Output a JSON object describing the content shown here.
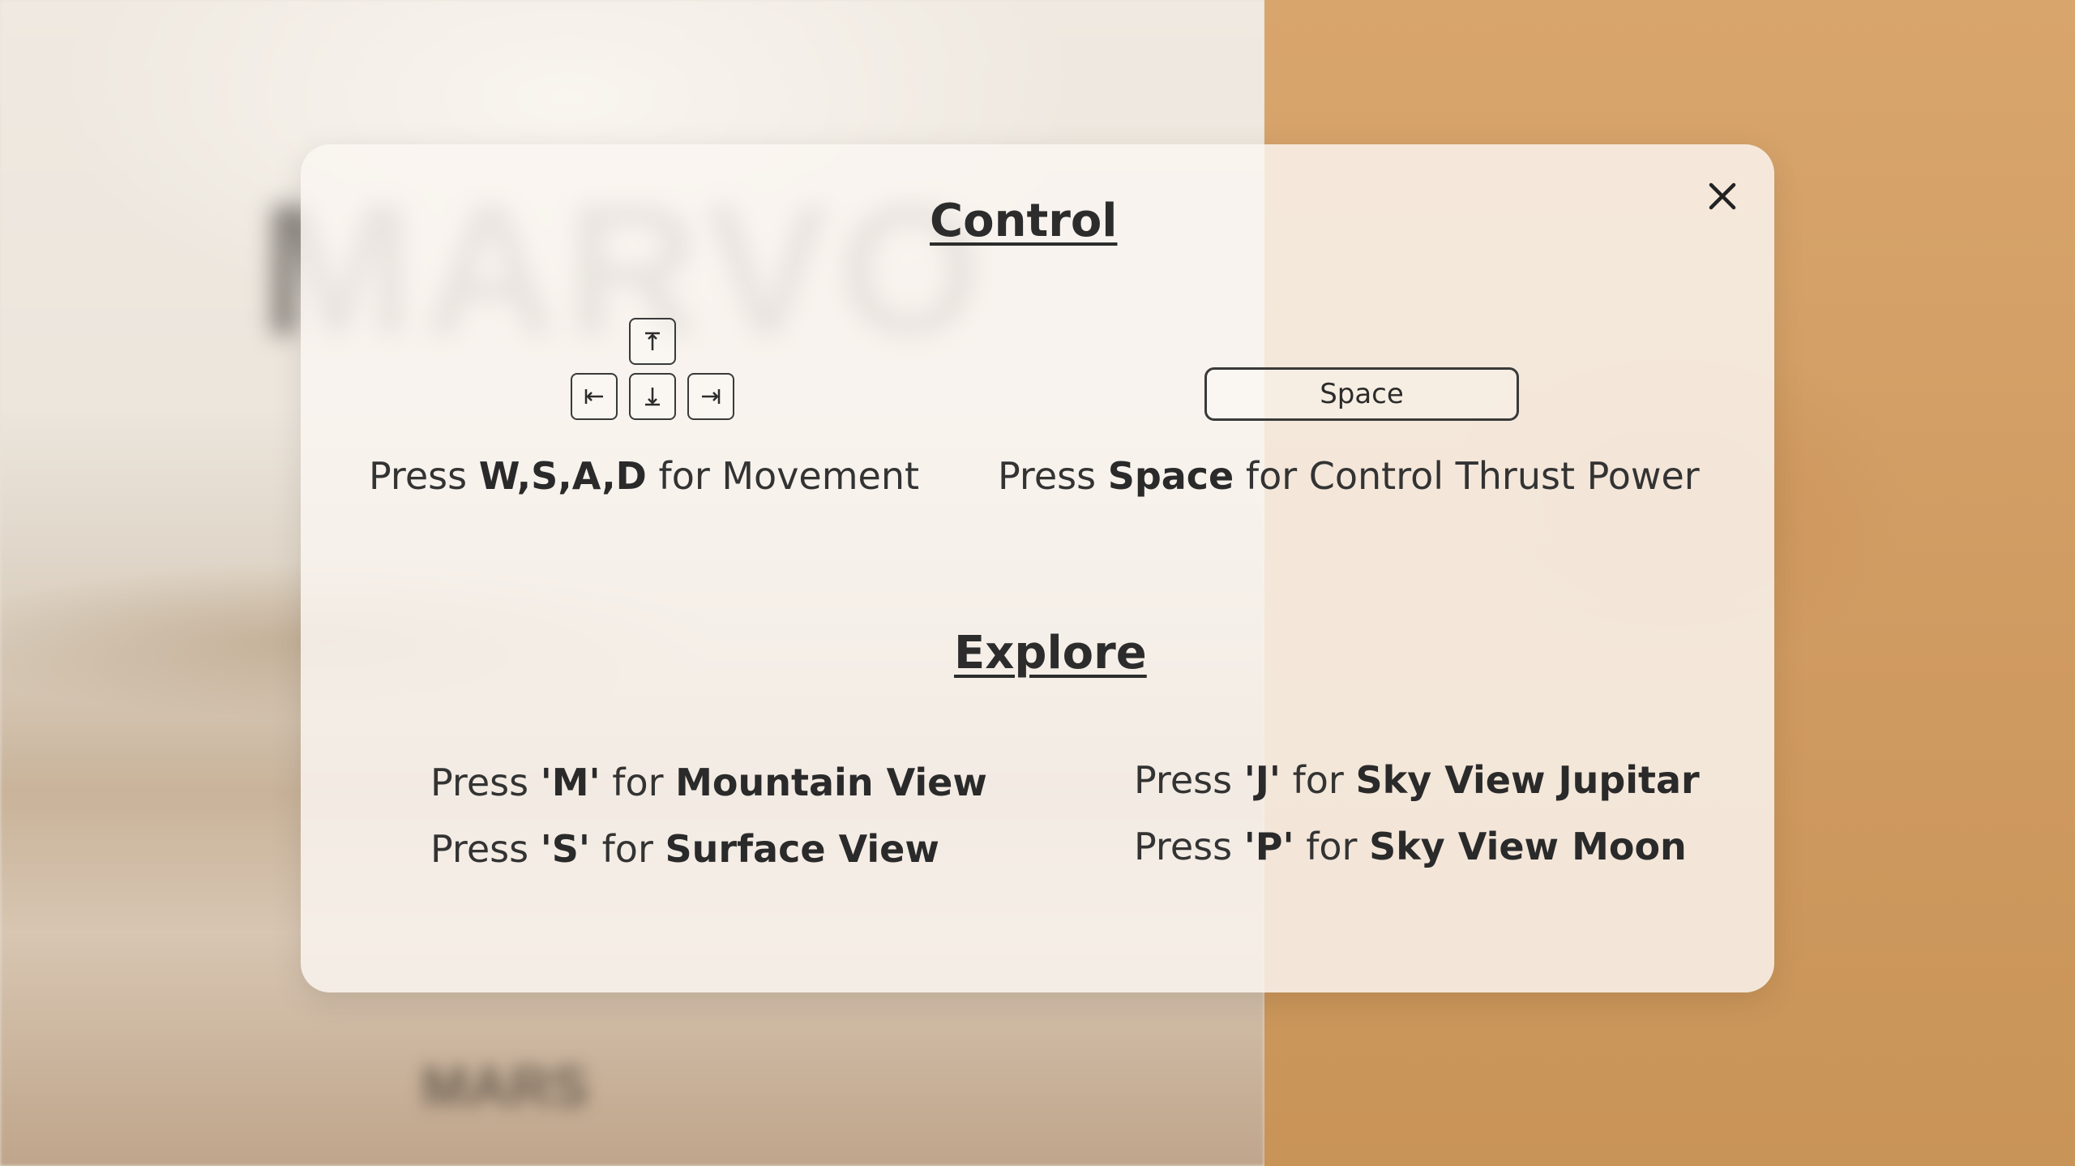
{
  "modal": {
    "close_icon": "close-icon"
  },
  "control": {
    "title": "Control",
    "keys": {
      "up_icon": "arrow-up-to-bar-icon",
      "left_icon": "arrow-left-to-bar-icon",
      "down_icon": "arrow-down-to-bar-icon",
      "right_icon": "arrow-right-to-bar-icon",
      "space_label": "Space"
    },
    "movement": {
      "prefix": "Press ",
      "keys": "W,S,A,D",
      "suffix": " for Movement"
    },
    "thrust": {
      "prefix": "Press ",
      "keys": "Space",
      "suffix": " for Control Thrust Power"
    }
  },
  "explore": {
    "title": "Explore",
    "items": [
      {
        "prefix": "Press ",
        "key": "'M'",
        "mid": " for ",
        "view": "Mountain View"
      },
      {
        "prefix": "Press ",
        "key": "'S'",
        "mid": " for ",
        "view": "Surface View"
      },
      {
        "prefix": "Press ",
        "key": "'J'",
        "mid": " for ",
        "view": "Sky View Jupitar"
      },
      {
        "prefix": "Press ",
        "key": "'P'",
        "mid": " for ",
        "view": "Sky View Moon"
      }
    ]
  }
}
